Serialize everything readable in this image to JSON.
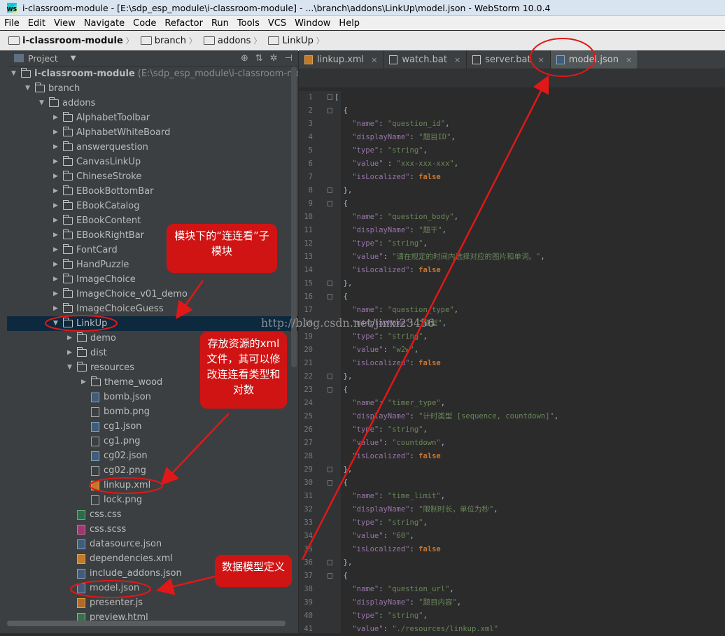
{
  "window": {
    "title": "i-classroom-module - [E:\\sdp_esp_module\\i-classroom-module] - ...\\branch\\addons\\LinkUp\\model.json - WebStorm 10.0.4"
  },
  "menu": [
    "File",
    "Edit",
    "View",
    "Navigate",
    "Code",
    "Refactor",
    "Run",
    "Tools",
    "VCS",
    "Window",
    "Help"
  ],
  "breadcrumb": [
    "i-classroom-module",
    "branch",
    "addons",
    "LinkUp"
  ],
  "project_panel": {
    "title": "Project",
    "dropdown_icon": "chevron-down-icon",
    "tool_icons": [
      "target-icon",
      "collapse-all-icon",
      "settings-icon",
      "hide-icon"
    ]
  },
  "tree": [
    {
      "label": "i-classroom-module",
      "hint": "(E:\\sdp_esp_module\\i-classroom-module",
      "depth": 0,
      "type": "folder",
      "expanded": true,
      "bold": true
    },
    {
      "label": "branch",
      "depth": 1,
      "type": "folder",
      "expanded": true
    },
    {
      "label": "addons",
      "depth": 2,
      "type": "folder",
      "expanded": true
    },
    {
      "label": "AlphabetToolbar",
      "depth": 3,
      "type": "folder",
      "expanded": false
    },
    {
      "label": "AlphabetWhiteBoard",
      "depth": 3,
      "type": "folder",
      "expanded": false
    },
    {
      "label": "answerquestion",
      "depth": 3,
      "type": "folder",
      "expanded": false
    },
    {
      "label": "CanvasLinkUp",
      "depth": 3,
      "type": "folder",
      "expanded": false
    },
    {
      "label": "ChineseStroke",
      "depth": 3,
      "type": "folder",
      "expanded": false
    },
    {
      "label": "EBookBottomBar",
      "depth": 3,
      "type": "folder",
      "expanded": false
    },
    {
      "label": "EBookCatalog",
      "depth": 3,
      "type": "folder",
      "expanded": false
    },
    {
      "label": "EBookContent",
      "depth": 3,
      "type": "folder",
      "expanded": false
    },
    {
      "label": "EBookRightBar",
      "depth": 3,
      "type": "folder",
      "expanded": false
    },
    {
      "label": "FontCard",
      "depth": 3,
      "type": "folder",
      "expanded": false
    },
    {
      "label": "HandPuzzle",
      "depth": 3,
      "type": "folder",
      "expanded": false
    },
    {
      "label": "ImageChoice",
      "depth": 3,
      "type": "folder",
      "expanded": false
    },
    {
      "label": "ImageChoice_v01_demo",
      "depth": 3,
      "type": "folder",
      "expanded": false
    },
    {
      "label": "ImageChoiceGuess",
      "depth": 3,
      "type": "folder",
      "expanded": false
    },
    {
      "label": "LinkUp",
      "depth": 3,
      "type": "folder",
      "expanded": true,
      "selected": true
    },
    {
      "label": "demo",
      "depth": 4,
      "type": "folder",
      "expanded": false
    },
    {
      "label": "dist",
      "depth": 4,
      "type": "folder",
      "expanded": false
    },
    {
      "label": "resources",
      "depth": 4,
      "type": "folder",
      "expanded": true
    },
    {
      "label": "theme_wood",
      "depth": 5,
      "type": "folder",
      "expanded": false
    },
    {
      "label": "bomb.json",
      "depth": 5,
      "type": "json"
    },
    {
      "label": "bomb.png",
      "depth": 5,
      "type": "png"
    },
    {
      "label": "cg1.json",
      "depth": 5,
      "type": "json"
    },
    {
      "label": "cg1.png",
      "depth": 5,
      "type": "png"
    },
    {
      "label": "cg02.json",
      "depth": 5,
      "type": "json"
    },
    {
      "label": "cg02.png",
      "depth": 5,
      "type": "png"
    },
    {
      "label": "linkup.xml",
      "depth": 5,
      "type": "xml"
    },
    {
      "label": "lock.png",
      "depth": 5,
      "type": "png"
    },
    {
      "label": "css.css",
      "depth": 4,
      "type": "css"
    },
    {
      "label": "css.scss",
      "depth": 4,
      "type": "scss"
    },
    {
      "label": "datasource.json",
      "depth": 4,
      "type": "json"
    },
    {
      "label": "dependencies.xml",
      "depth": 4,
      "type": "xml"
    },
    {
      "label": "include_addons.json",
      "depth": 4,
      "type": "json"
    },
    {
      "label": "model.json",
      "depth": 4,
      "type": "json"
    },
    {
      "label": "presenter.js",
      "depth": 4,
      "type": "js"
    },
    {
      "label": "preview.html",
      "depth": 4,
      "type": "html"
    }
  ],
  "tabs": [
    {
      "label": "linkup.xml",
      "icon": "xml-file-icon",
      "active": false
    },
    {
      "label": "watch.bat",
      "icon": "text-file-icon",
      "active": false
    },
    {
      "label": "server.bat",
      "icon": "text-file-icon",
      "active": false
    },
    {
      "label": "model.json",
      "icon": "json-file-icon",
      "active": true
    }
  ],
  "code_lines": [
    [
      [
        "p",
        "["
      ]
    ],
    [
      [
        "p",
        "  {"
      ]
    ],
    [
      [
        "p",
        "    "
      ],
      [
        "key",
        "\"name\""
      ],
      [
        "p",
        ": "
      ],
      [
        "str",
        "\"question_id\""
      ],
      [
        "p",
        ","
      ]
    ],
    [
      [
        "p",
        "    "
      ],
      [
        "key",
        "\"displayName\""
      ],
      [
        "p",
        ": "
      ],
      [
        "str",
        "\"题目ID\""
      ],
      [
        "p",
        ","
      ]
    ],
    [
      [
        "p",
        "    "
      ],
      [
        "key",
        "\"type\""
      ],
      [
        "p",
        ": "
      ],
      [
        "str",
        "\"string\""
      ],
      [
        "p",
        ","
      ]
    ],
    [
      [
        "p",
        "    "
      ],
      [
        "key",
        "\"value\""
      ],
      [
        "p",
        " : "
      ],
      [
        "str",
        "\"xxx-xxx-xxx\""
      ],
      [
        "p",
        ","
      ]
    ],
    [
      [
        "p",
        "    "
      ],
      [
        "key",
        "\"isLocalized\""
      ],
      [
        "p",
        ": "
      ],
      [
        "kw",
        "false"
      ]
    ],
    [
      [
        "p",
        "  },"
      ]
    ],
    [
      [
        "p",
        "  {"
      ]
    ],
    [
      [
        "p",
        "    "
      ],
      [
        "key",
        "\"name\""
      ],
      [
        "p",
        ": "
      ],
      [
        "str",
        "\"question_body\""
      ],
      [
        "p",
        ","
      ]
    ],
    [
      [
        "p",
        "    "
      ],
      [
        "key",
        "\"displayName\""
      ],
      [
        "p",
        ": "
      ],
      [
        "str",
        "\"题干\""
      ],
      [
        "p",
        ","
      ]
    ],
    [
      [
        "p",
        "    "
      ],
      [
        "key",
        "\"type\""
      ],
      [
        "p",
        ": "
      ],
      [
        "str",
        "\"string\""
      ],
      [
        "p",
        ","
      ]
    ],
    [
      [
        "p",
        "    "
      ],
      [
        "key",
        "\"value\""
      ],
      [
        "p",
        ": "
      ],
      [
        "str",
        "\"请在规定的时间内选择对应的图片和单词。\""
      ],
      [
        "p",
        ","
      ]
    ],
    [
      [
        "p",
        "    "
      ],
      [
        "key",
        "\"isLocalized\""
      ],
      [
        "p",
        ": "
      ],
      [
        "kw",
        "false"
      ]
    ],
    [
      [
        "p",
        "  },"
      ]
    ],
    [
      [
        "p",
        "  {"
      ]
    ],
    [
      [
        "p",
        "    "
      ],
      [
        "key",
        "\"name\""
      ],
      [
        "p",
        ": "
      ],
      [
        "str",
        "\"question_type\""
      ],
      [
        "p",
        ","
      ]
    ],
    [
      [
        "p",
        "    "
      ],
      [
        "key",
        "\"displayName\""
      ],
      [
        "p",
        ": "
      ],
      [
        "str",
        "\"题型\""
      ],
      [
        "p",
        ","
      ]
    ],
    [
      [
        "p",
        "    "
      ],
      [
        "key",
        "\"type\""
      ],
      [
        "p",
        ": "
      ],
      [
        "str",
        "\"string\""
      ],
      [
        "p",
        ","
      ]
    ],
    [
      [
        "p",
        "    "
      ],
      [
        "key",
        "\"value\""
      ],
      [
        "p",
        ": "
      ],
      [
        "str",
        "\"w2w\""
      ],
      [
        "p",
        ","
      ]
    ],
    [
      [
        "p",
        "    "
      ],
      [
        "key",
        "\"isLocalized\""
      ],
      [
        "p",
        ": "
      ],
      [
        "kw",
        "false"
      ]
    ],
    [
      [
        "p",
        "  },"
      ]
    ],
    [
      [
        "p",
        "  {"
      ]
    ],
    [
      [
        "p",
        "    "
      ],
      [
        "key",
        "\"name\""
      ],
      [
        "p",
        ": "
      ],
      [
        "str",
        "\"timer_type\""
      ],
      [
        "p",
        ","
      ]
    ],
    [
      [
        "p",
        "    "
      ],
      [
        "key",
        "\"displayName\""
      ],
      [
        "p",
        ": "
      ],
      [
        "str",
        "\"计时类型 [sequence, countdown]\""
      ],
      [
        "p",
        ","
      ]
    ],
    [
      [
        "p",
        "    "
      ],
      [
        "key",
        "\"type\""
      ],
      [
        "p",
        ": "
      ],
      [
        "str",
        "\"string\""
      ],
      [
        "p",
        ","
      ]
    ],
    [
      [
        "p",
        "    "
      ],
      [
        "key",
        "\"value\""
      ],
      [
        "p",
        ": "
      ],
      [
        "str",
        "\"countdown\""
      ],
      [
        "p",
        ","
      ]
    ],
    [
      [
        "p",
        "    "
      ],
      [
        "key",
        "\"isLocalized\""
      ],
      [
        "p",
        ": "
      ],
      [
        "kw",
        "false"
      ]
    ],
    [
      [
        "p",
        "  },"
      ]
    ],
    [
      [
        "p",
        "  {"
      ]
    ],
    [
      [
        "p",
        "    "
      ],
      [
        "key",
        "\"name\""
      ],
      [
        "p",
        ": "
      ],
      [
        "str",
        "\"time_limit\""
      ],
      [
        "p",
        ","
      ]
    ],
    [
      [
        "p",
        "    "
      ],
      [
        "key",
        "\"displayName\""
      ],
      [
        "p",
        ": "
      ],
      [
        "str",
        "\"限制时长，单位为秒\""
      ],
      [
        "p",
        ","
      ]
    ],
    [
      [
        "p",
        "    "
      ],
      [
        "key",
        "\"type\""
      ],
      [
        "p",
        ": "
      ],
      [
        "str",
        "\"string\""
      ],
      [
        "p",
        ","
      ]
    ],
    [
      [
        "p",
        "    "
      ],
      [
        "key",
        "\"value\""
      ],
      [
        "p",
        ": "
      ],
      [
        "str",
        "\"60\""
      ],
      [
        "p",
        ","
      ]
    ],
    [
      [
        "p",
        "    "
      ],
      [
        "key",
        "\"isLocalized\""
      ],
      [
        "p",
        ": "
      ],
      [
        "kw",
        "false"
      ]
    ],
    [
      [
        "p",
        "  },"
      ]
    ],
    [
      [
        "p",
        "  {"
      ]
    ],
    [
      [
        "p",
        "    "
      ],
      [
        "key",
        "\"name\""
      ],
      [
        "p",
        ": "
      ],
      [
        "str",
        "\"question_url\""
      ],
      [
        "p",
        ","
      ]
    ],
    [
      [
        "p",
        "    "
      ],
      [
        "key",
        "\"displayName\""
      ],
      [
        "p",
        ": "
      ],
      [
        "str",
        "\"题目内容\""
      ],
      [
        "p",
        ","
      ]
    ],
    [
      [
        "p",
        "    "
      ],
      [
        "key",
        "\"type\""
      ],
      [
        "p",
        ": "
      ],
      [
        "str",
        "\"string\""
      ],
      [
        "p",
        ","
      ]
    ],
    [
      [
        "p",
        "    "
      ],
      [
        "key",
        "\"value\""
      ],
      [
        "p",
        ": "
      ],
      [
        "str",
        "\"./resources/linkup.xml\""
      ]
    ]
  ],
  "watermark": "http://blog.csdn.net/jinxi23456",
  "annotations": {
    "submodule_note": "模块下的“连连看”子模块",
    "resource_note": "存放资源的xml文件，其可以修改连连看类型和对数",
    "model_note": "数据模型定义"
  },
  "colors": {
    "annotation": "#d01414",
    "selection": "#0d293e",
    "editor_bg": "#2b2b2b",
    "panel_bg": "#3c3f41"
  }
}
